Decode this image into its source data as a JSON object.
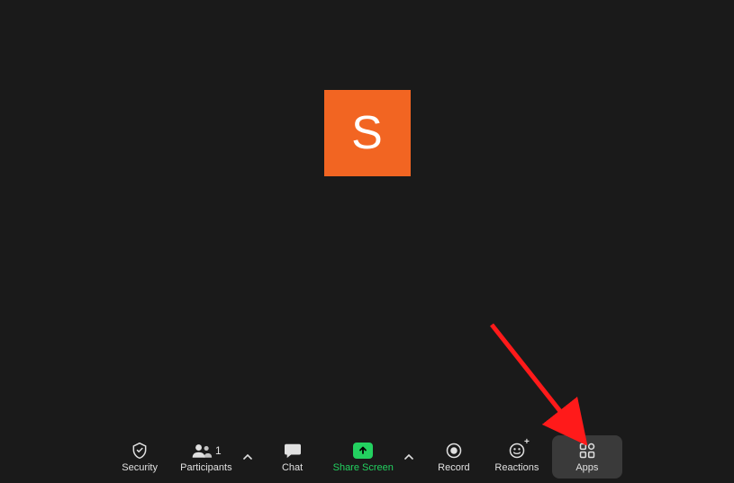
{
  "avatar": {
    "letter": "S",
    "bg": "#f26522"
  },
  "toolbar": {
    "security": {
      "label": "Security"
    },
    "participants": {
      "label": "Participants",
      "count": "1"
    },
    "chat": {
      "label": "Chat"
    },
    "share": {
      "label": "Share Screen"
    },
    "record": {
      "label": "Record"
    },
    "reactions": {
      "label": "Reactions"
    },
    "apps": {
      "label": "Apps"
    }
  }
}
